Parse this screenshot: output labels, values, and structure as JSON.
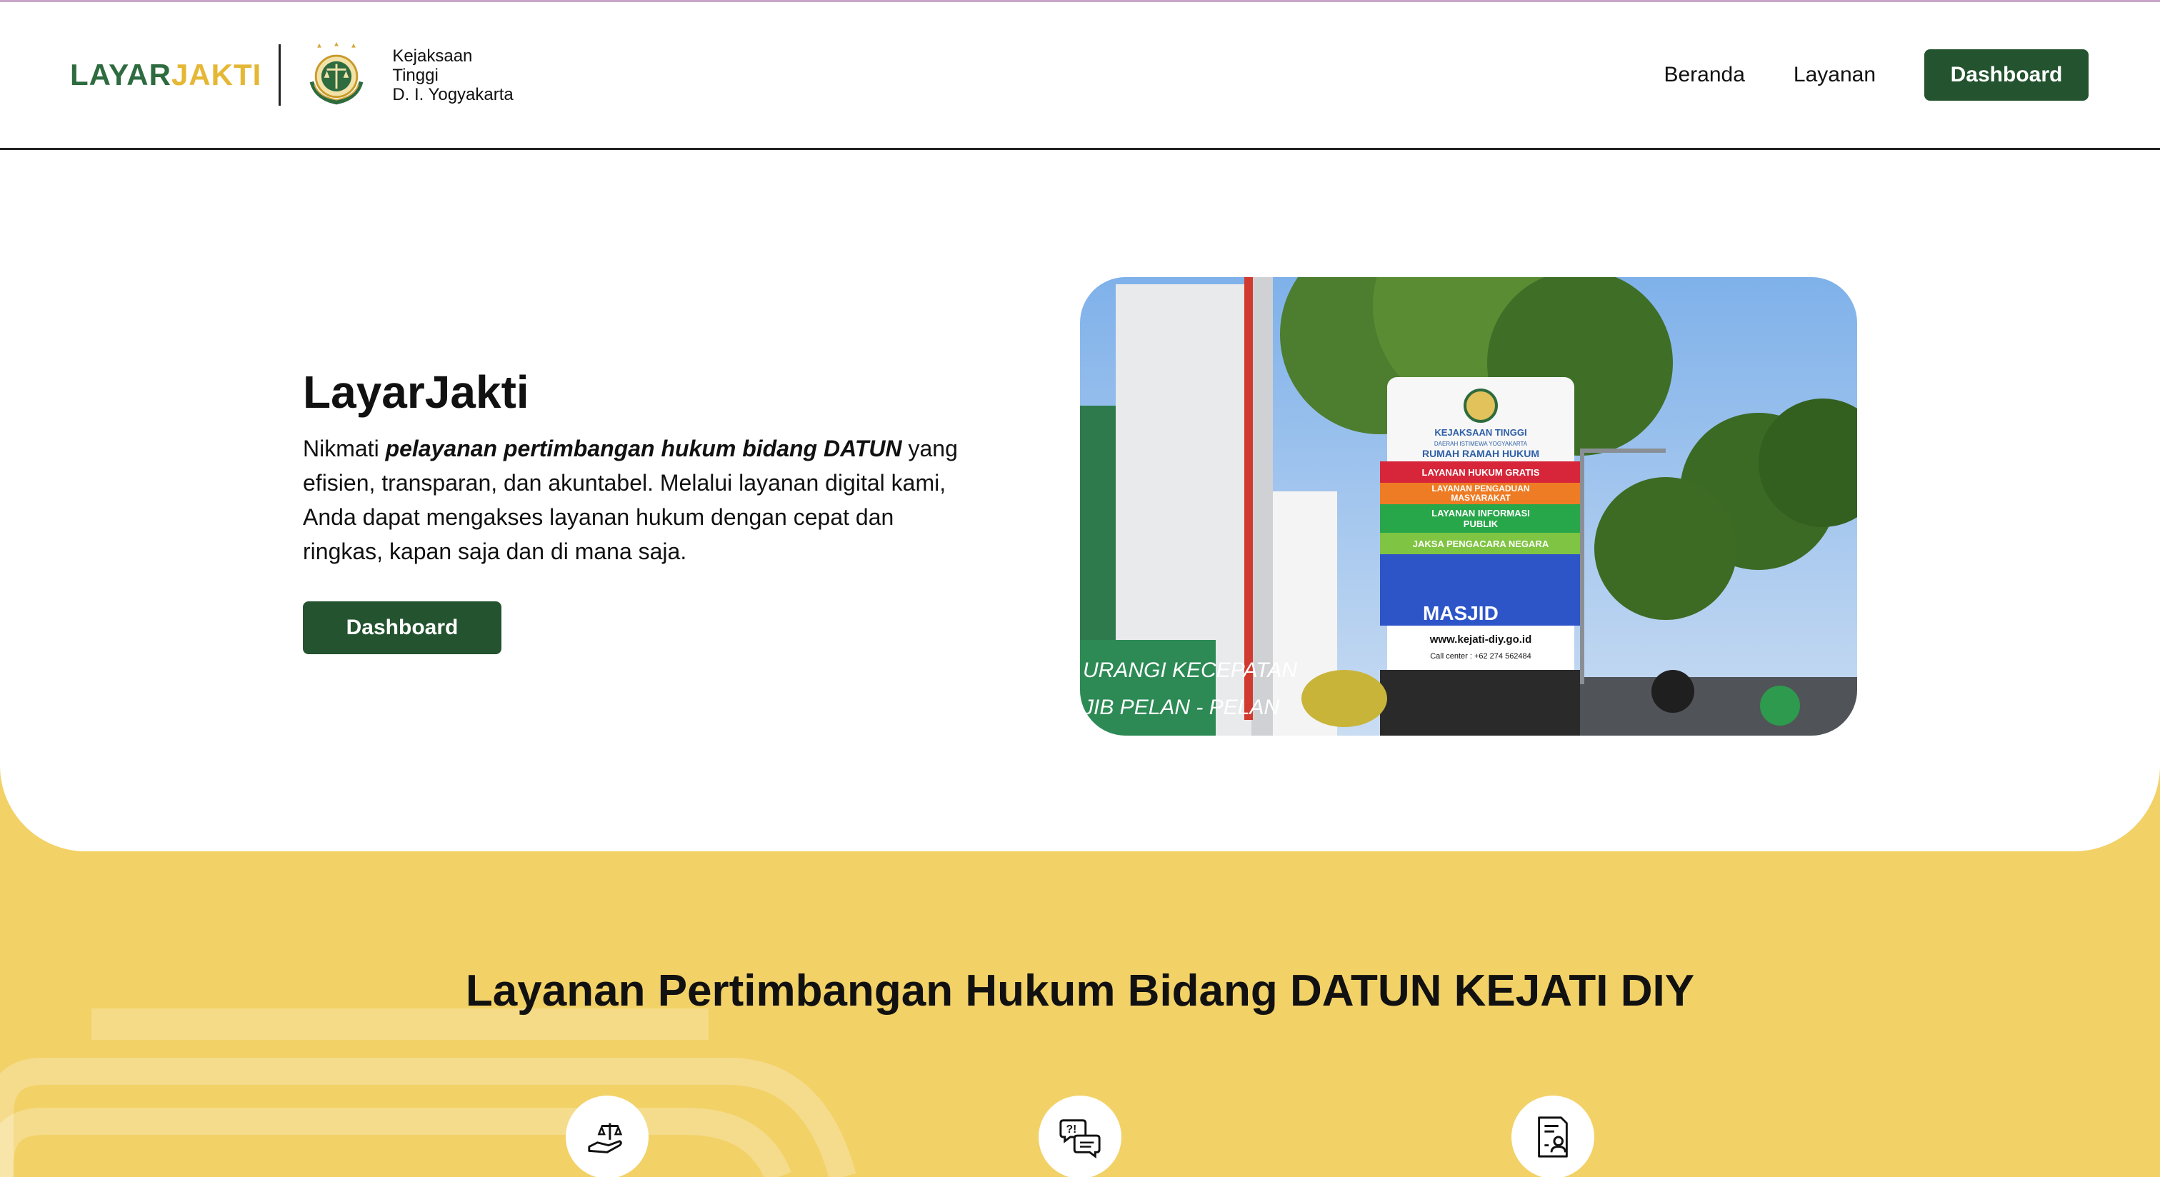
{
  "header": {
    "brand_part1": "LAYAR",
    "brand_part2": "JAKTI",
    "org_line1": "Kejaksaan",
    "org_line2": "Tinggi",
    "org_line3": "D. I. Yogyakarta",
    "nav": {
      "home": "Beranda",
      "services": "Layanan",
      "dashboard": "Dashboard"
    }
  },
  "hero": {
    "title": "LayarJakti",
    "desc_prefix": "Nikmati ",
    "desc_emphasis": "pelayanan pertimbangan hukum bidang DATUN",
    "desc_suffix": " yang efisien, transparan, dan akuntabel. Melalui layanan digital kami, Anda dapat mengakses layanan hukum dengan cepat dan ringkas, kapan saja dan di mana saja.",
    "button": "Dashboard",
    "photo_sign": {
      "header1": "KEJAKSAAN TINGGI",
      "header2": "DAERAH ISTIMEWA YOGYAKARTA",
      "header3": "RUMAH RAMAH HUKUM",
      "row1": "LAYANAN HUKUM GRATIS",
      "row2a": "LAYANAN PENGADUAN",
      "row2b": "MASYARAKAT",
      "row3a": "LAYANAN INFORMASI",
      "row3b": "PUBLIK",
      "row4": "JAKSA PENGACARA NEGARA",
      "masjid": "MASJID",
      "website": "www.kejati-diy.go.id",
      "callcenter": "Call center : +62 274 562484",
      "banner1": "URANGI KECEPATAN",
      "banner2": "JIB PELAN - PELAN"
    }
  },
  "services": {
    "title": "Layanan Pertimbangan Hukum Bidang DATUN KEJATI DIY",
    "icons": [
      "legal-scale-hand-icon",
      "consultation-chat-icon",
      "document-user-icon"
    ]
  },
  "colors": {
    "primary_green": "#23532f",
    "brand_green": "#2e6b3f",
    "brand_yellow": "#e5b735",
    "section_yellow": "#f2d166"
  }
}
